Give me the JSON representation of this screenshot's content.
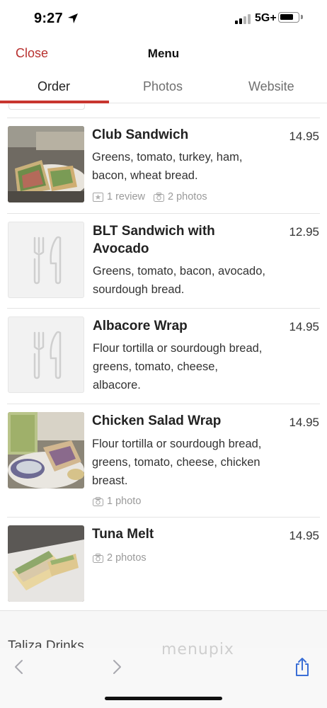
{
  "status_bar": {
    "time": "9:27",
    "network": "5G+"
  },
  "header": {
    "close_label": "Close",
    "title": "Menu"
  },
  "tabs": [
    {
      "label": "Order",
      "active": true
    },
    {
      "label": "Photos",
      "active": false
    },
    {
      "label": "Website",
      "active": false
    }
  ],
  "items": [
    {
      "name": "Club Sandwich",
      "price": "14.95",
      "description": [
        "Greens, tomato, turkey, ham,",
        "bacon, wheat bread."
      ],
      "reviews": "1 review",
      "photos": "2 photos",
      "image": "club-sandwich-photo"
    },
    {
      "name": "BLT Sandwich with Avocado",
      "name_lines": [
        "BLT Sandwich with",
        "Avocado"
      ],
      "price": "12.95",
      "description": [
        "Greens, tomato, bacon, avocado,",
        "sourdough bread."
      ],
      "image": "fork-knife-placeholder-icon"
    },
    {
      "name": "Albacore Wrap",
      "price": "14.95",
      "description": [
        "Flour tortilla or sourdough bread,",
        "greens, tomato, cheese,",
        "albacore."
      ],
      "image": "fork-knife-placeholder-icon"
    },
    {
      "name": "Chicken Salad Wrap",
      "price": "14.95",
      "description": [
        "Flour tortilla or sourdough bread,",
        "greens, tomato, cheese, chicken",
        "breast."
      ],
      "photos": "1 photo",
      "image": "chicken-salad-wrap-photo"
    },
    {
      "name": "Tuna Melt",
      "price": "14.95",
      "photos": "2 photos",
      "image": "tuna-melt-photo"
    }
  ],
  "next_section": {
    "title": "Taliza Drinks"
  },
  "watermark": "menupix",
  "colors": {
    "accent": "#c8362f",
    "close": "#b8312f",
    "meta": "#9a9a9a"
  }
}
